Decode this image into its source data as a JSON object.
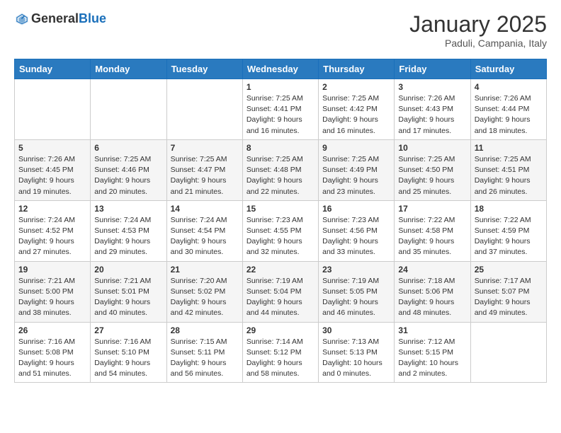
{
  "header": {
    "logo_general": "General",
    "logo_blue": "Blue",
    "title": "January 2025",
    "location": "Paduli, Campania, Italy"
  },
  "weekdays": [
    "Sunday",
    "Monday",
    "Tuesday",
    "Wednesday",
    "Thursday",
    "Friday",
    "Saturday"
  ],
  "weeks": [
    [
      {
        "day": "",
        "info": ""
      },
      {
        "day": "",
        "info": ""
      },
      {
        "day": "",
        "info": ""
      },
      {
        "day": "1",
        "info": "Sunrise: 7:25 AM\nSunset: 4:41 PM\nDaylight: 9 hours\nand 16 minutes."
      },
      {
        "day": "2",
        "info": "Sunrise: 7:25 AM\nSunset: 4:42 PM\nDaylight: 9 hours\nand 16 minutes."
      },
      {
        "day": "3",
        "info": "Sunrise: 7:26 AM\nSunset: 4:43 PM\nDaylight: 9 hours\nand 17 minutes."
      },
      {
        "day": "4",
        "info": "Sunrise: 7:26 AM\nSunset: 4:44 PM\nDaylight: 9 hours\nand 18 minutes."
      }
    ],
    [
      {
        "day": "5",
        "info": "Sunrise: 7:26 AM\nSunset: 4:45 PM\nDaylight: 9 hours\nand 19 minutes."
      },
      {
        "day": "6",
        "info": "Sunrise: 7:25 AM\nSunset: 4:46 PM\nDaylight: 9 hours\nand 20 minutes."
      },
      {
        "day": "7",
        "info": "Sunrise: 7:25 AM\nSunset: 4:47 PM\nDaylight: 9 hours\nand 21 minutes."
      },
      {
        "day": "8",
        "info": "Sunrise: 7:25 AM\nSunset: 4:48 PM\nDaylight: 9 hours\nand 22 minutes."
      },
      {
        "day": "9",
        "info": "Sunrise: 7:25 AM\nSunset: 4:49 PM\nDaylight: 9 hours\nand 23 minutes."
      },
      {
        "day": "10",
        "info": "Sunrise: 7:25 AM\nSunset: 4:50 PM\nDaylight: 9 hours\nand 25 minutes."
      },
      {
        "day": "11",
        "info": "Sunrise: 7:25 AM\nSunset: 4:51 PM\nDaylight: 9 hours\nand 26 minutes."
      }
    ],
    [
      {
        "day": "12",
        "info": "Sunrise: 7:24 AM\nSunset: 4:52 PM\nDaylight: 9 hours\nand 27 minutes."
      },
      {
        "day": "13",
        "info": "Sunrise: 7:24 AM\nSunset: 4:53 PM\nDaylight: 9 hours\nand 29 minutes."
      },
      {
        "day": "14",
        "info": "Sunrise: 7:24 AM\nSunset: 4:54 PM\nDaylight: 9 hours\nand 30 minutes."
      },
      {
        "day": "15",
        "info": "Sunrise: 7:23 AM\nSunset: 4:55 PM\nDaylight: 9 hours\nand 32 minutes."
      },
      {
        "day": "16",
        "info": "Sunrise: 7:23 AM\nSunset: 4:56 PM\nDaylight: 9 hours\nand 33 minutes."
      },
      {
        "day": "17",
        "info": "Sunrise: 7:22 AM\nSunset: 4:58 PM\nDaylight: 9 hours\nand 35 minutes."
      },
      {
        "day": "18",
        "info": "Sunrise: 7:22 AM\nSunset: 4:59 PM\nDaylight: 9 hours\nand 37 minutes."
      }
    ],
    [
      {
        "day": "19",
        "info": "Sunrise: 7:21 AM\nSunset: 5:00 PM\nDaylight: 9 hours\nand 38 minutes."
      },
      {
        "day": "20",
        "info": "Sunrise: 7:21 AM\nSunset: 5:01 PM\nDaylight: 9 hours\nand 40 minutes."
      },
      {
        "day": "21",
        "info": "Sunrise: 7:20 AM\nSunset: 5:02 PM\nDaylight: 9 hours\nand 42 minutes."
      },
      {
        "day": "22",
        "info": "Sunrise: 7:19 AM\nSunset: 5:04 PM\nDaylight: 9 hours\nand 44 minutes."
      },
      {
        "day": "23",
        "info": "Sunrise: 7:19 AM\nSunset: 5:05 PM\nDaylight: 9 hours\nand 46 minutes."
      },
      {
        "day": "24",
        "info": "Sunrise: 7:18 AM\nSunset: 5:06 PM\nDaylight: 9 hours\nand 48 minutes."
      },
      {
        "day": "25",
        "info": "Sunrise: 7:17 AM\nSunset: 5:07 PM\nDaylight: 9 hours\nand 49 minutes."
      }
    ],
    [
      {
        "day": "26",
        "info": "Sunrise: 7:16 AM\nSunset: 5:08 PM\nDaylight: 9 hours\nand 51 minutes."
      },
      {
        "day": "27",
        "info": "Sunrise: 7:16 AM\nSunset: 5:10 PM\nDaylight: 9 hours\nand 54 minutes."
      },
      {
        "day": "28",
        "info": "Sunrise: 7:15 AM\nSunset: 5:11 PM\nDaylight: 9 hours\nand 56 minutes."
      },
      {
        "day": "29",
        "info": "Sunrise: 7:14 AM\nSunset: 5:12 PM\nDaylight: 9 hours\nand 58 minutes."
      },
      {
        "day": "30",
        "info": "Sunrise: 7:13 AM\nSunset: 5:13 PM\nDaylight: 10 hours\nand 0 minutes."
      },
      {
        "day": "31",
        "info": "Sunrise: 7:12 AM\nSunset: 5:15 PM\nDaylight: 10 hours\nand 2 minutes."
      },
      {
        "day": "",
        "info": ""
      }
    ]
  ]
}
